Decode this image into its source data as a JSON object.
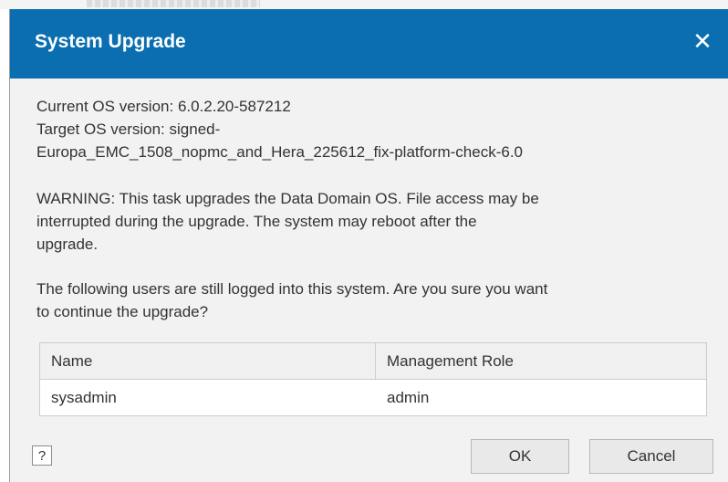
{
  "dialog": {
    "title": "System Upgrade",
    "close_glyph": "✕",
    "version_lines": [
      "Current OS version: 6.0.2.20-587212",
      "Target OS version: signed-",
      "Europa_EMC_1508_nopmc_and_Hera_225612_fix-platform-check-6.0"
    ],
    "warning_lines": [
      "WARNING: This task upgrades the Data Domain OS. File access may be",
      "interrupted during the upgrade. The system may reboot after the",
      "upgrade."
    ],
    "question_lines": [
      "The following users are still logged into this system. Are you sure you want",
      "to continue the upgrade?"
    ],
    "table": {
      "columns": [
        "Name",
        "Management Role"
      ],
      "rows": [
        [
          "sysadmin",
          "admin"
        ]
      ]
    },
    "help_label": "?",
    "ok_label": "OK",
    "cancel_label": "Cancel"
  },
  "colors": {
    "titlebar": "#0a6eb0",
    "dialog_bg": "#f2f2f2"
  },
  "icons": {
    "close": "close-icon",
    "help": "help-icon"
  }
}
